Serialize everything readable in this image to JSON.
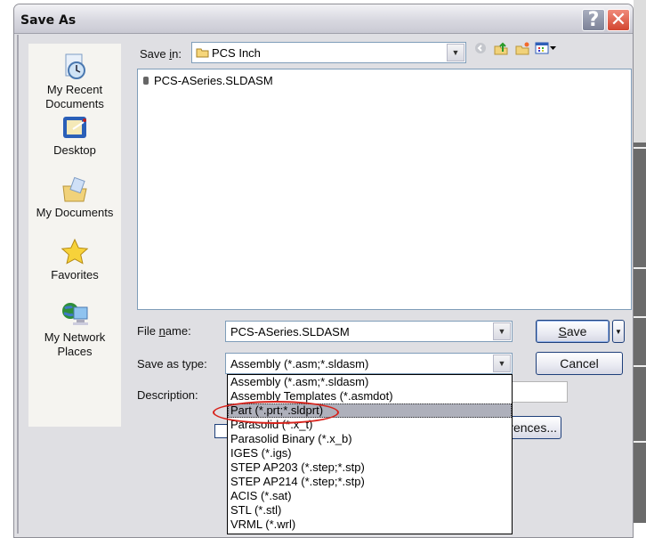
{
  "window": {
    "title": "Save As",
    "help_label": "?",
    "close_label": "✕"
  },
  "places": [
    {
      "label_1": "My Recent",
      "label_2": "Documents",
      "icon": "recent-documents-icon"
    },
    {
      "label_1": "Desktop",
      "label_2": "",
      "icon": "desktop-icon"
    },
    {
      "label_1": "My Documents",
      "label_2": "",
      "icon": "my-documents-icon"
    },
    {
      "label_1": "Favorites",
      "label_2": "",
      "icon": "favorites-star-icon"
    },
    {
      "label_1": "My Network",
      "label_2": "Places",
      "icon": "network-places-icon"
    }
  ],
  "save_in": {
    "label_pre": "Save ",
    "label_u": "i",
    "label_post": "n:",
    "value": "PCS Inch"
  },
  "toolbar": {
    "back": "back-icon",
    "up": "up-folder-icon",
    "new_folder": "new-folder-icon",
    "views": "views-menu-icon"
  },
  "files": [
    {
      "name": "PCS-ASeries.SLDASM",
      "icon": "assembly-file-icon"
    }
  ],
  "file_name": {
    "label_pre": "File ",
    "label_u": "n",
    "label_post": "ame:",
    "value": "PCS-ASeries.SLDASM"
  },
  "save_as_type": {
    "label": "Save as type:",
    "value": "Assembly (*.asm;*.sldasm)"
  },
  "description": {
    "label": "Description:",
    "value": ""
  },
  "buttons": {
    "save_u": "S",
    "save_rest": "ave",
    "cancel": "Cancel",
    "references": "erences..."
  },
  "type_options": [
    "Assembly (*.asm;*.sldasm)",
    "Assembly Templates (*.asmdot)",
    "Part (*.prt;*.sldprt)",
    "Parasolid (*.x_t)",
    "Parasolid Binary (*.x_b)",
    "IGES (*.igs)",
    "STEP AP203 (*.step;*.stp)",
    "STEP AP214 (*.step;*.stp)",
    "ACIS (*.sat)",
    "STL (*.stl)",
    "VRML (*.wrl)"
  ],
  "highlighted_option_index": 2,
  "annotation_color": "#d7221b"
}
